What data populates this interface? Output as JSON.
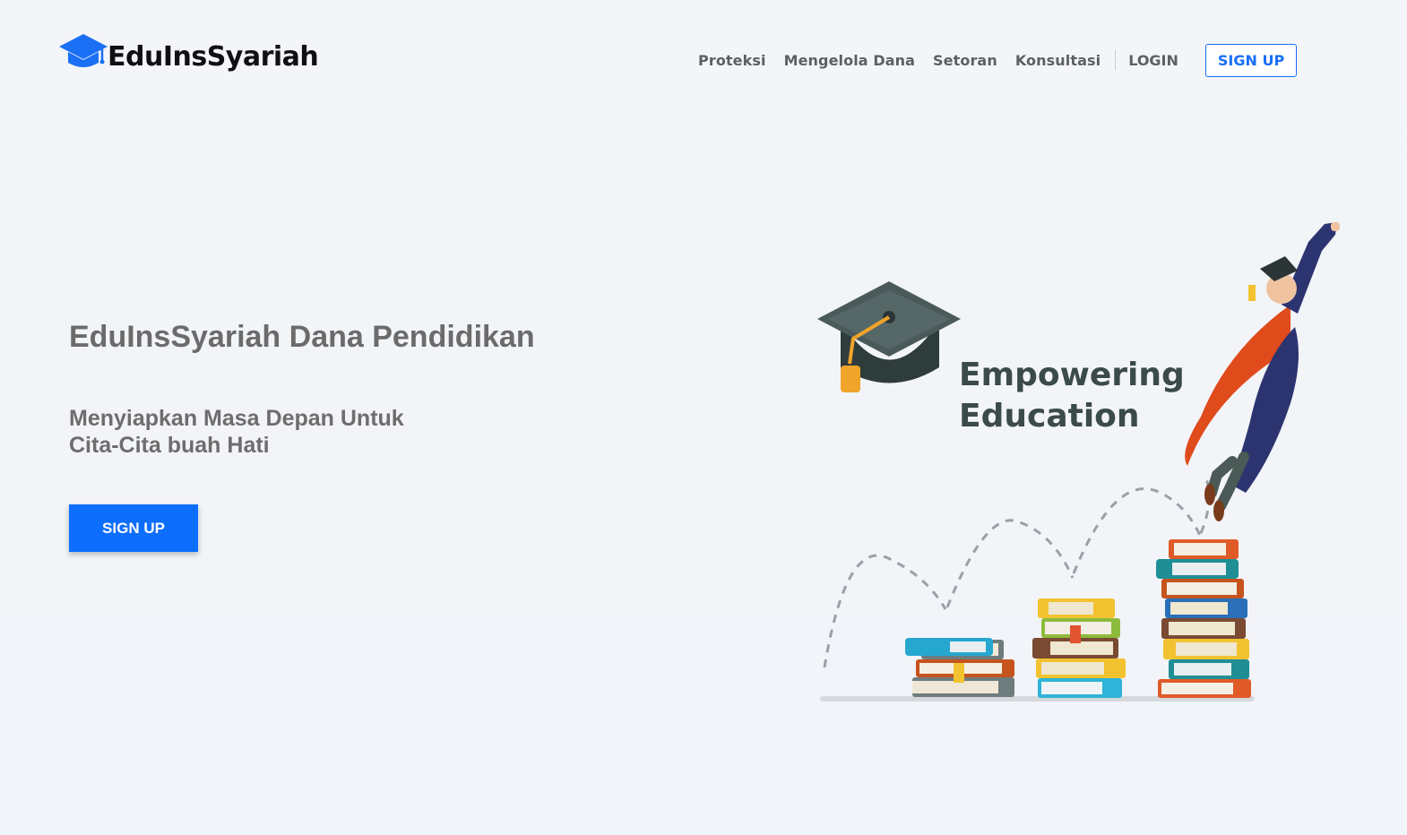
{
  "header": {
    "brand": "EduInsSyariah",
    "nav": [
      "Proteksi",
      "Mengelola Dana",
      "Setoran",
      "Konsultasi"
    ],
    "login_label": "LOGIN",
    "signup_label": "SIGN UP"
  },
  "hero": {
    "title": "EduInsSyariah Dana Pendidikan",
    "subtitle_line1": "Menyiapkan Masa Depan Untuk",
    "subtitle_line2": "Cita-Cita buah Hati",
    "cta_label": "SIGN UP"
  },
  "illustration": {
    "line1": "Empowering",
    "line2": "Education"
  },
  "colors": {
    "brand": "#1a6ff5",
    "cta": "#0d6efd",
    "text_gray": "#6b6b6b"
  },
  "icons": {
    "logo": "graduation-cap-icon"
  }
}
